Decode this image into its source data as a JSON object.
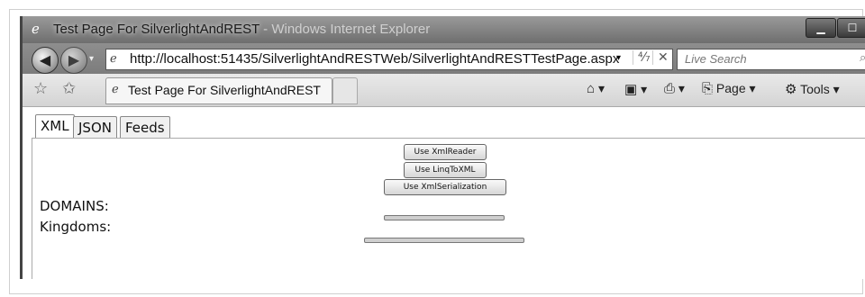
{
  "window": {
    "title_main": "Test Page For SilverlightAndREST",
    "title_suffix": " - Windows Internet Explorer",
    "buttons": {
      "minimize": "▁",
      "maximize": "☐",
      "close": "✕"
    }
  },
  "addressbar": {
    "url": "http://localhost:51435/SilverlightAndRESTWeb/SilverlightAndRESTTestPage.aspx",
    "dropdown_glyph": "▾",
    "refresh_glyph": "⁴⁄₇",
    "stop_glyph": "✕"
  },
  "search": {
    "placeholder": "Live Search",
    "icon": "search-icon"
  },
  "tabbar": {
    "tab_label": "Test Page For SilverlightAndREST",
    "commands": {
      "page": "Page ▾",
      "tools": "Tools ▾"
    }
  },
  "app": {
    "tabs": [
      {
        "label": "XML"
      },
      {
        "label": "JSON"
      },
      {
        "label": "Feeds"
      }
    ],
    "active_tab": "XML",
    "buttons": {
      "xmlreader": "Use XmlReader",
      "linqtoxml": "Use LinqToXML",
      "xmlserialization": "Use XmlSerialization"
    },
    "labels": {
      "domains": "DOMAINS:",
      "kingdoms": "Kingdoms:"
    }
  }
}
